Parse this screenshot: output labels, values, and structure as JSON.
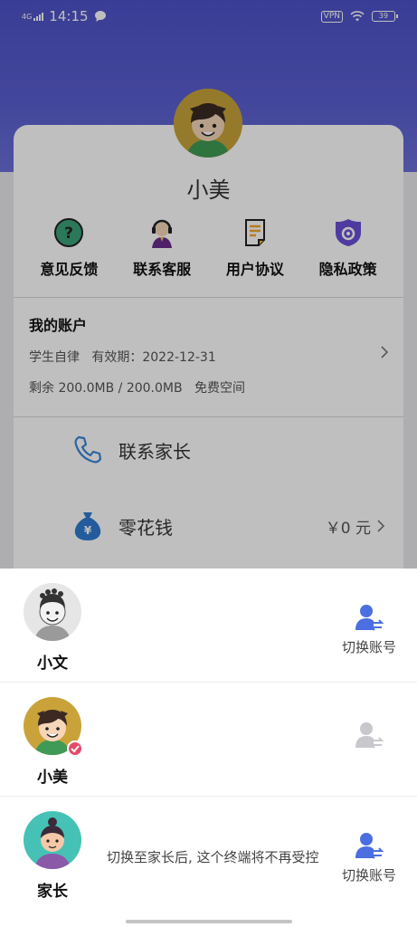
{
  "status_bar": {
    "network": "4G",
    "time": "14:15",
    "vpn": "VPN",
    "battery": "39"
  },
  "profile": {
    "name": "小美"
  },
  "quick_actions": [
    {
      "label": "意见反馈",
      "icon": "feedback-icon"
    },
    {
      "label": "联系客服",
      "icon": "customer-service-icon"
    },
    {
      "label": "用户协议",
      "icon": "agreement-icon"
    },
    {
      "label": "隐私政策",
      "icon": "privacy-icon"
    }
  ],
  "account": {
    "title": "我的账户",
    "plan": "学生自律",
    "validity_label": "有效期：",
    "validity_date": "2022-12-31",
    "storage": "剩余 200.0MB / 200.0MB",
    "storage_note": "免费空间"
  },
  "menu": {
    "contact_parent": "联系家长",
    "pocket_money": "零花钱",
    "pocket_money_value": "￥0 元"
  },
  "accounts": [
    {
      "name": "小文",
      "switch_label": "切换账号",
      "active": false
    },
    {
      "name": "小美",
      "switch_label": "",
      "active": true
    },
    {
      "name": "家长",
      "switch_label": "切换账号",
      "note": "切换至家长后, 这个终端将不再受控",
      "active": false
    }
  ],
  "colors": {
    "header_gradient_top": "#4e52c7",
    "switch_blue": "#4b6fe0",
    "active_check": "#e64a6b",
    "disabled_gray": "#c8c8cc"
  }
}
